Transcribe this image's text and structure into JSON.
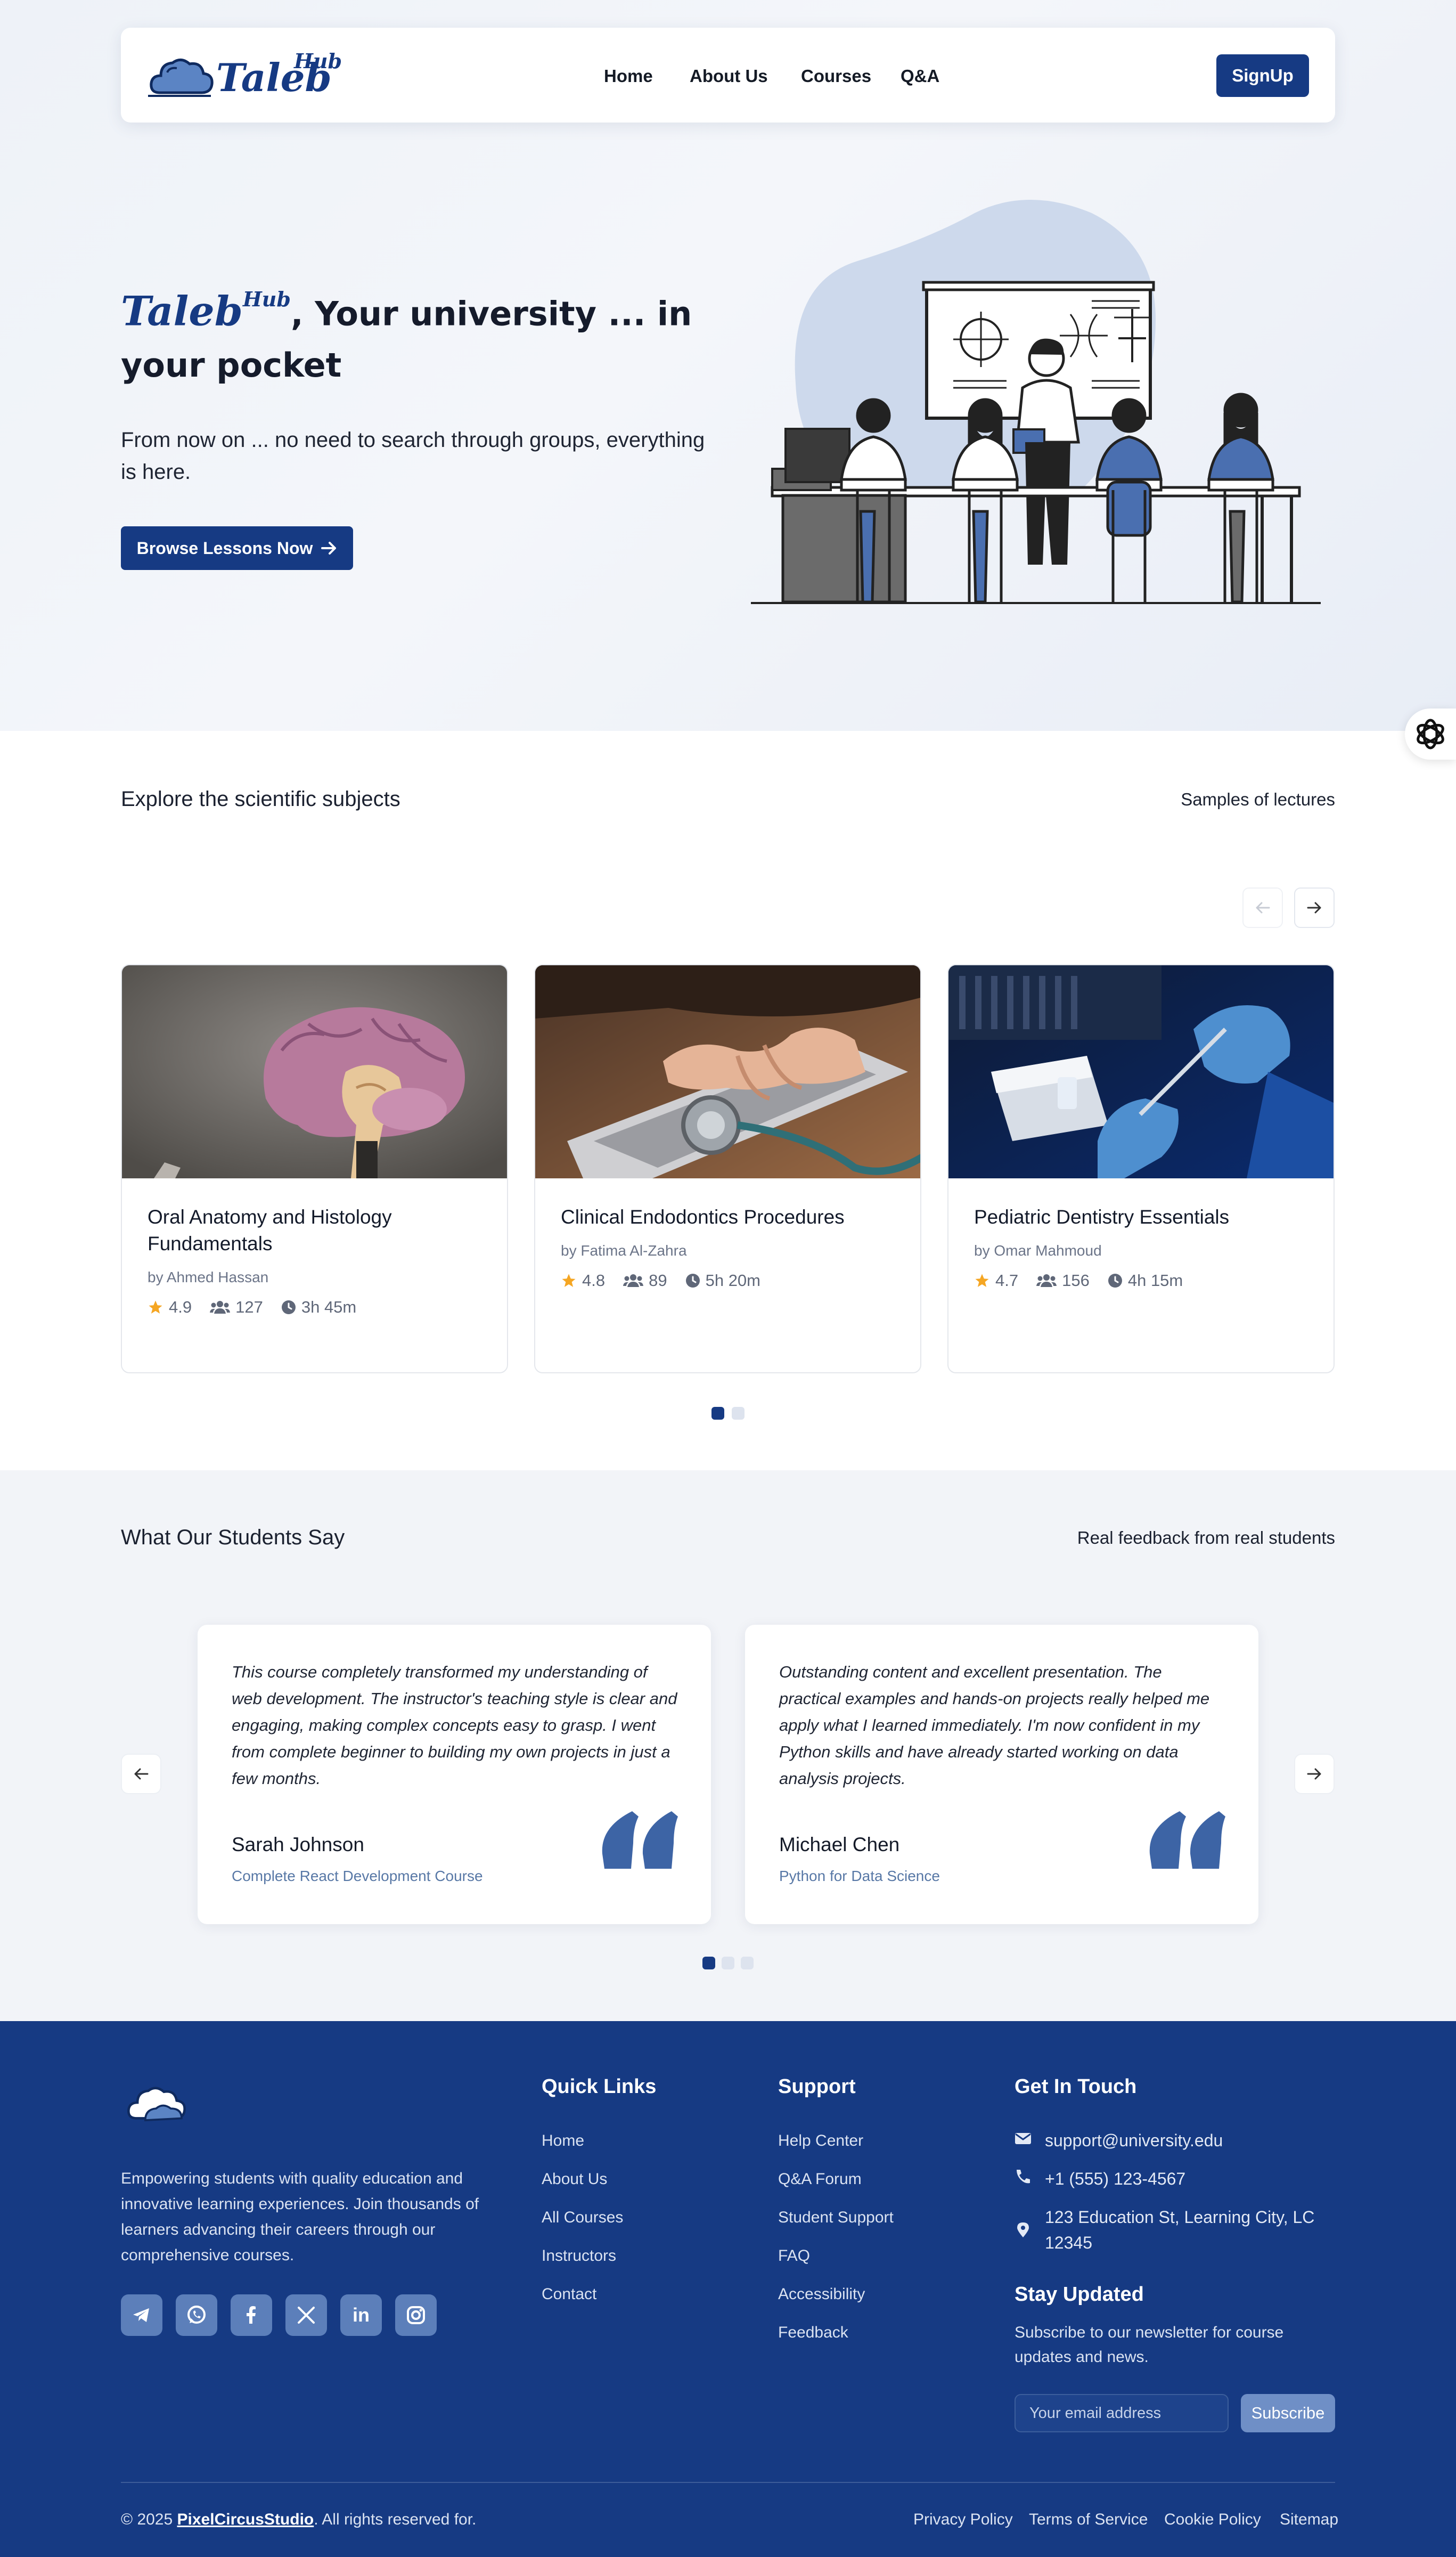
{
  "brand": {
    "logo_text": "Taleb",
    "logo_superscript": "Hub",
    "primary_color": "#163a83",
    "accent_color": "#4a6fb0"
  },
  "nav": {
    "links": [
      "Home",
      "About Us",
      "Courses",
      "Q&A"
    ],
    "signup_label": "SignUp"
  },
  "hero": {
    "title_rest": ", Your university ... in your pocket",
    "subtitle": "From now on ... no need to search through groups, everything is here.",
    "cta_label": "Browse Lessons Now",
    "cta_icon": "arrow-right-icon",
    "floating_icon": "openai-icon"
  },
  "subjects": {
    "title": "Explore the scientific subjects",
    "right_label": "Samples of lectures",
    "courses": [
      {
        "title": "Oral Anatomy and Histology Fundamentals",
        "author": "by Ahmed Hassan",
        "rating": "4.9",
        "students": "127",
        "duration": "3h 45m",
        "image": "brain-model-photo"
      },
      {
        "title": "Clinical Endodontics Procedures",
        "author": "by Fatima Al-Zahra",
        "rating": "4.8",
        "students": "89",
        "duration": "5h 20m",
        "image": "laptop-stethoscope-photo"
      },
      {
        "title": "Pediatric Dentistry Essentials",
        "author": "by Omar Mahmoud",
        "rating": "4.7",
        "students": "156",
        "duration": "4h 15m",
        "image": "lab-gloves-photo"
      }
    ],
    "pagination": {
      "pages": 2,
      "active": 1
    }
  },
  "testimonials": {
    "title": "What Our Students Say",
    "right_label": "Real feedback from real students",
    "items": [
      {
        "quote": "This course completely transformed my understanding of web development. The instructor's teaching style is clear and engaging, making complex concepts easy to grasp. I went from complete beginner to building my own projects in just a few months.",
        "name": "Sarah Johnson",
        "course": "Complete React Development Course"
      },
      {
        "quote": "Outstanding content and excellent presentation. The practical examples and hands-on projects really helped me apply what I learned immediately. I'm now confident in my Python skills and have already started working on data analysis projects.",
        "name": "Michael Chen",
        "course": "Python for Data Science"
      }
    ],
    "pagination": {
      "pages": 3,
      "active": 1
    }
  },
  "footer": {
    "description": "Empowering students with quality education and innovative learning experiences. Join thousands of learners advancing their careers through our comprehensive courses.",
    "socials": [
      "telegram-icon",
      "whatsapp-icon",
      "facebook-icon",
      "x-icon",
      "linkedin-icon",
      "instagram-icon"
    ],
    "quick_links_title": "Quick Links",
    "quick_links": [
      "Home",
      "About Us",
      "All Courses",
      "Instructors",
      "Contact"
    ],
    "support_title": "Support",
    "support_links": [
      "Help Center",
      "Q&A Forum",
      "Student Support",
      "FAQ",
      "Accessibility",
      "Feedback"
    ],
    "contact_title": "Get In Touch",
    "email": "support@university.edu",
    "phone": "+1 (555) 123-4567",
    "address": "123 Education St, Learning City, LC 12345",
    "newsletter_title": "Stay Updated",
    "newsletter_text": "Subscribe to our newsletter for course updates and news.",
    "email_placeholder": "Your email address",
    "subscribe_label": "Subscribe",
    "copyright_prefix": "© 2025 ",
    "copyright_brand": "PixelCircusStudio",
    "copyright_suffix": ". All rights reserved for.",
    "legal_links": [
      "Privacy Policy",
      "Terms of Service",
      "Cookie Policy",
      "Sitemap"
    ]
  }
}
